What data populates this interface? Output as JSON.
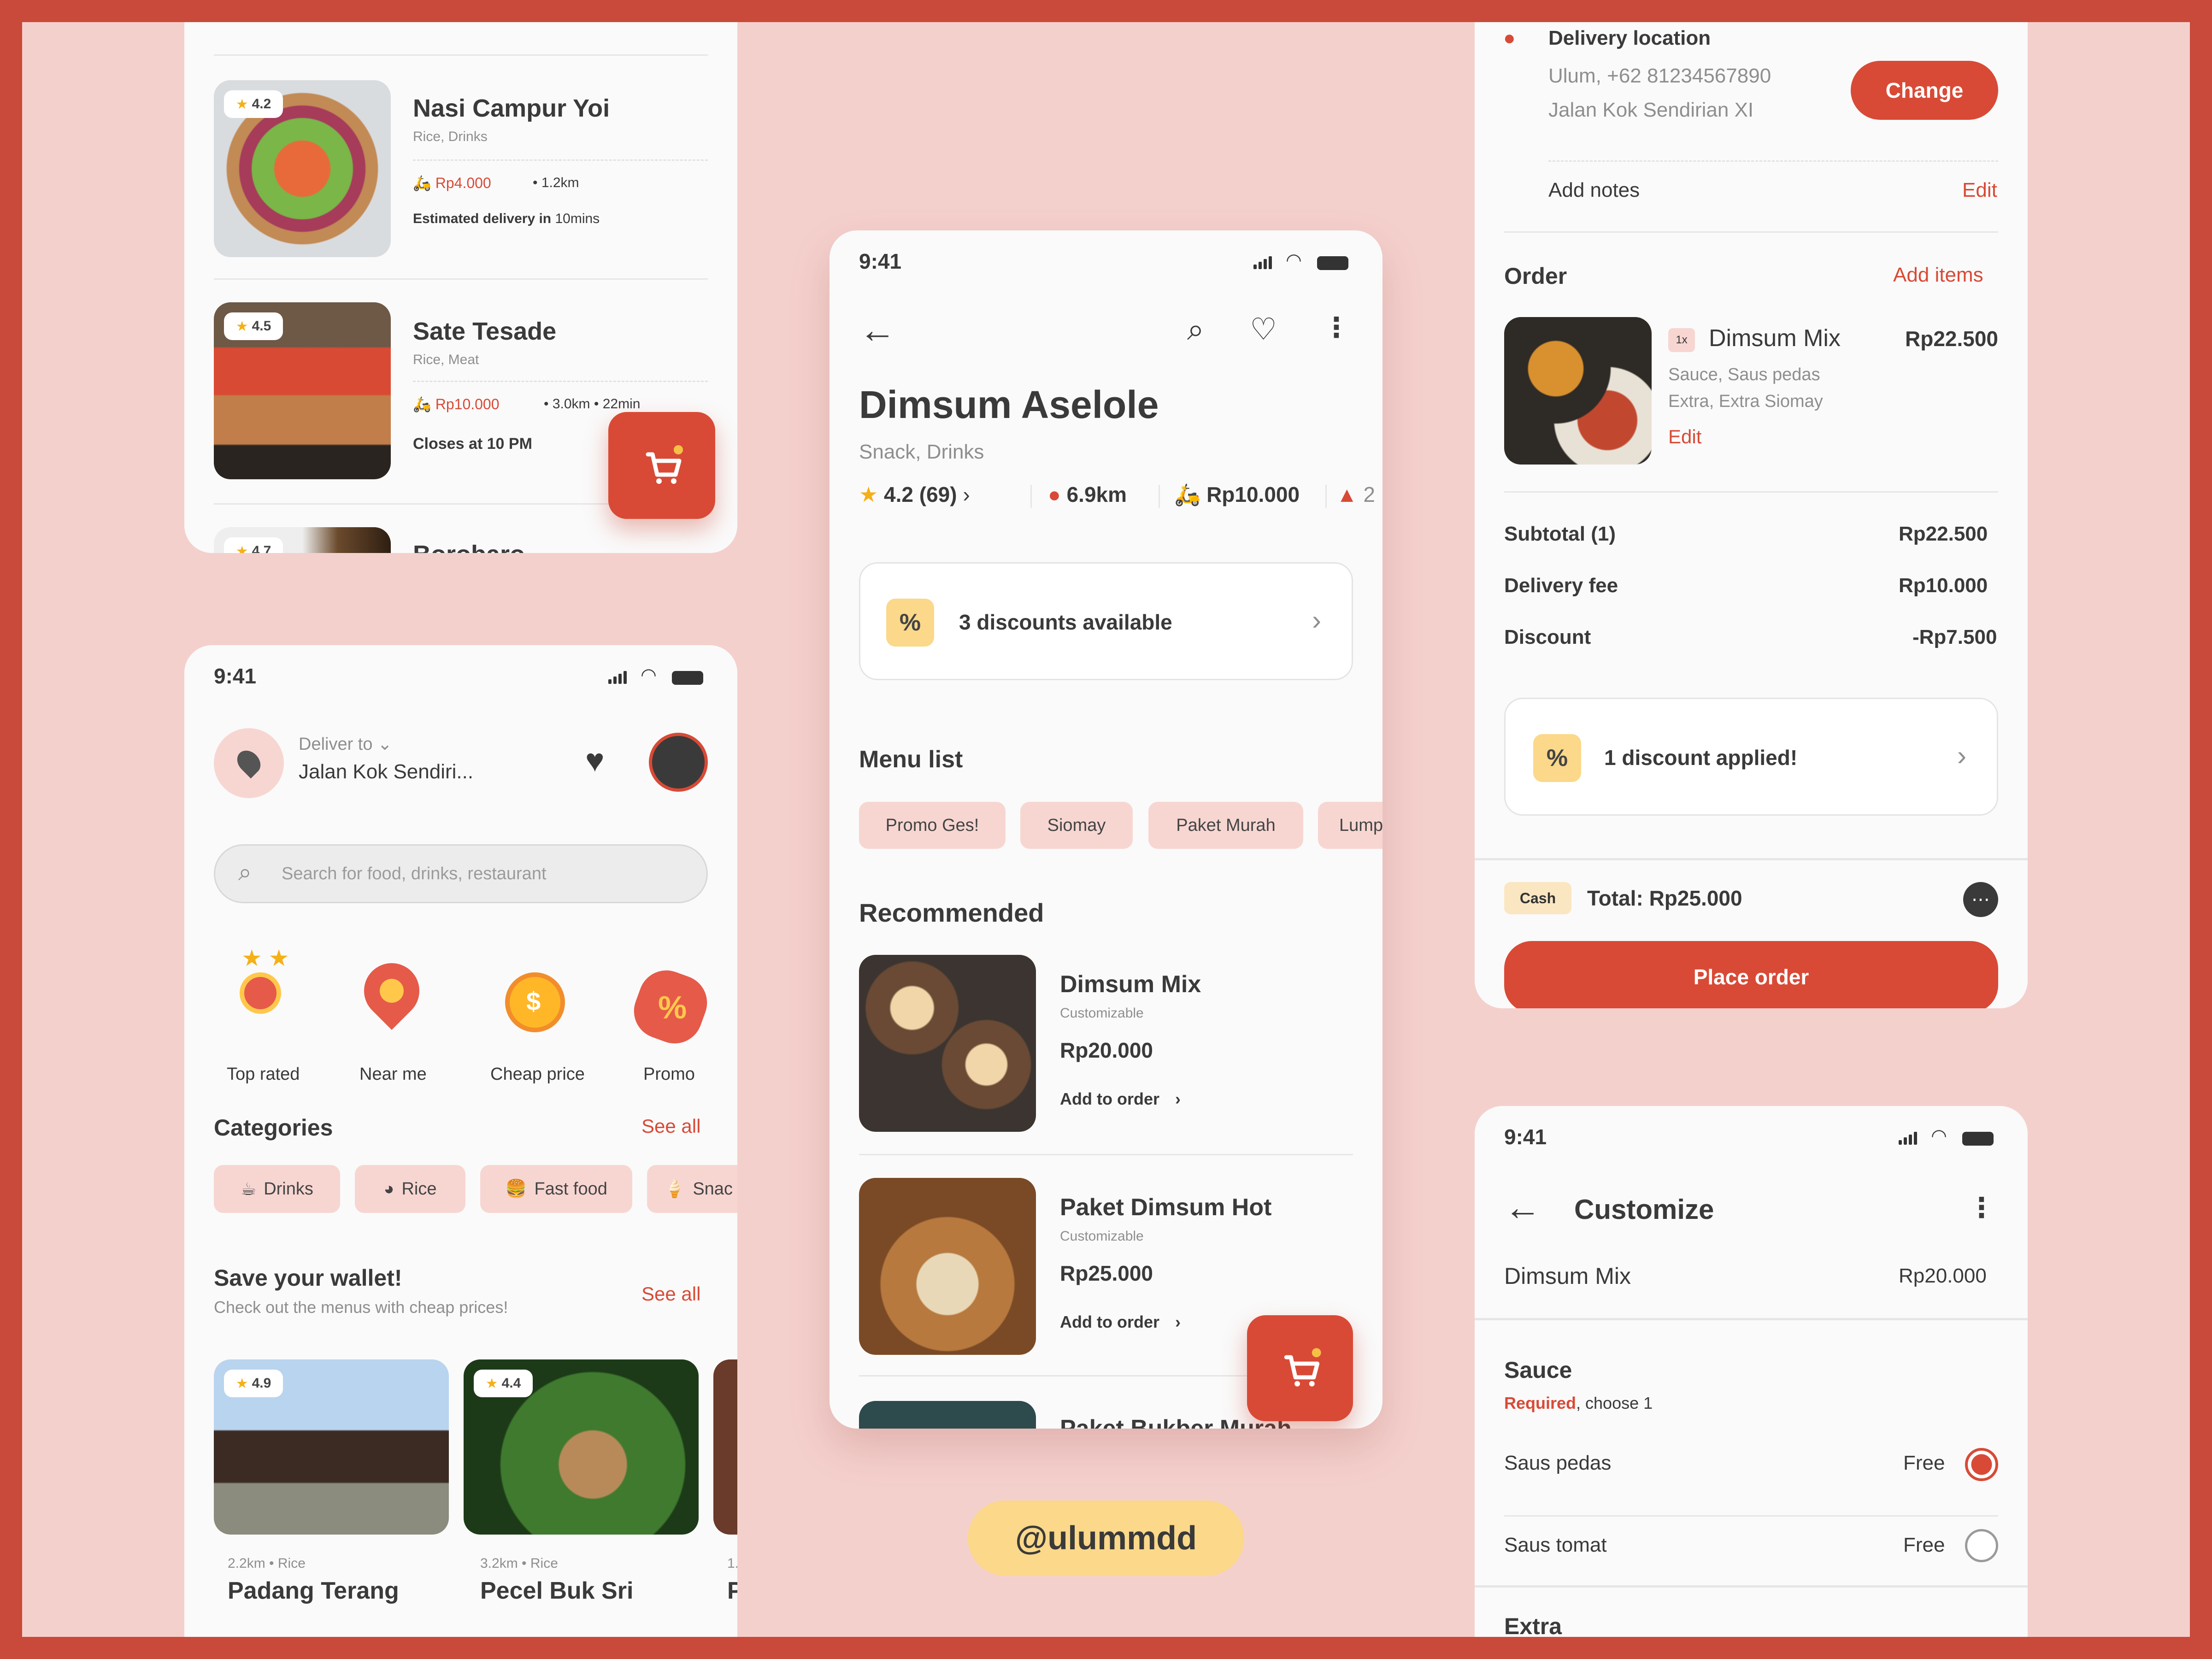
{
  "status_time": "9:41",
  "handle": "@ulummdd",
  "colors": {
    "accent": "#d84a36",
    "page_bg": "#f4d0cd",
    "frame": "#c94a3a",
    "card": "#fafafa",
    "discount_chip": "#fbd88a"
  },
  "list_screen": {
    "items": [
      {
        "name": "Nasi Campur Yoi",
        "tags": "Rice, Drinks",
        "rating": "4.2",
        "fee": "Rp4.000",
        "meta": "• 1.2km",
        "extra_label": "Estimated delivery in",
        "extra_value": "10mins"
      },
      {
        "name": "Sate Tesade",
        "tags": "Rice, Meat",
        "rating": "4.5",
        "fee": "Rp10.000",
        "meta": "• 3.0km • 22min",
        "extra_label": "Closes at 10 PM",
        "extra_value": ""
      },
      {
        "name": "Borobaro",
        "rating": "4.7"
      }
    ],
    "cart_icon": "cart-icon"
  },
  "home_screen": {
    "deliver_to_label": "Deliver to",
    "address": "Jalan Kok Sendiri...",
    "search_placeholder": "Search for food, drinks, restaurant",
    "quick": [
      {
        "label": "Top rated",
        "icon": "medal-icon"
      },
      {
        "label": "Near me",
        "icon": "location-pin-icon"
      },
      {
        "label": "Cheap price",
        "icon": "coin-icon"
      },
      {
        "label": "Promo",
        "icon": "promo-badge-icon"
      }
    ],
    "categories_title": "Categories",
    "see_all": "See all",
    "categories": [
      {
        "label": "Drinks",
        "icon": "cup-icon"
      },
      {
        "label": "Rice",
        "icon": "rice-bowl-icon"
      },
      {
        "label": "Fast food",
        "icon": "burger-icon"
      },
      {
        "label": "Snac",
        "icon": "ice-cream-icon"
      }
    ],
    "wallet_title": "Save your wallet!",
    "wallet_subtitle": "Check out the menus with cheap prices!",
    "wallet_items": [
      {
        "rating": "4.9",
        "distance": "2.2km",
        "tag": "Rice",
        "name": "Padang Terang"
      },
      {
        "rating": "4.4",
        "distance": "3.2km",
        "tag": "Rice",
        "name": "Pecel Buk Sri"
      },
      {
        "distance": "1.",
        "name": "P"
      }
    ]
  },
  "restaurant_screen": {
    "name": "Dimsum Aselole",
    "tags": "Snack, Drinks",
    "rating": "4.2 (69)",
    "distance": "6.9km",
    "delivery_fee": "Rp10.000",
    "extra_stat": "2",
    "discount_text": "3 discounts available",
    "discount_symbol": "%",
    "menu_title": "Menu list",
    "menu_chips": [
      "Promo Ges!",
      "Siomay",
      "Paket Murah",
      "Lump"
    ],
    "recommended_title": "Recommended",
    "items": [
      {
        "name": "Dimsum Mix",
        "note": "Customizable",
        "price": "Rp20.000",
        "action": "Add to order"
      },
      {
        "name": "Paket Dimsum Hot",
        "note": "Customizable",
        "price": "Rp25.000",
        "action": "Add to order"
      },
      {
        "name": "Paket Bukber Murah"
      }
    ]
  },
  "checkout_screen": {
    "location_title": "Delivery location",
    "contact": "Ulum, +62 81234567890",
    "street": "Jalan Kok Sendirian XI",
    "change_label": "Change",
    "notes_label": "Add notes",
    "edit_label": "Edit",
    "order_title": "Order",
    "add_items": "Add items",
    "order_item": {
      "qty": "1x",
      "name": "Dimsum Mix",
      "price": "Rp22.500",
      "opt1": "Sauce, Saus pedas",
      "opt2": "Extra, Extra Siomay",
      "edit": "Edit"
    },
    "subtotal_label": "Subtotal (1)",
    "subtotal": "Rp22.500",
    "delivery_label": "Delivery fee",
    "delivery": "Rp10.000",
    "discount_label": "Discount",
    "discount": "-Rp7.500",
    "discount_applied": "1 discount applied!",
    "payment": "Cash",
    "total": "Total: Rp25.000",
    "place_order": "Place order"
  },
  "customize_screen": {
    "title": "Customize",
    "item": "Dimsum Mix",
    "price": "Rp20.000",
    "section": "Sauce",
    "required": "Required",
    "choose": ", choose 1",
    "options": [
      {
        "label": "Saus pedas",
        "price": "Free",
        "selected": true
      },
      {
        "label": "Saus tomat",
        "price": "Free",
        "selected": false
      }
    ],
    "next_section": "Extra"
  }
}
